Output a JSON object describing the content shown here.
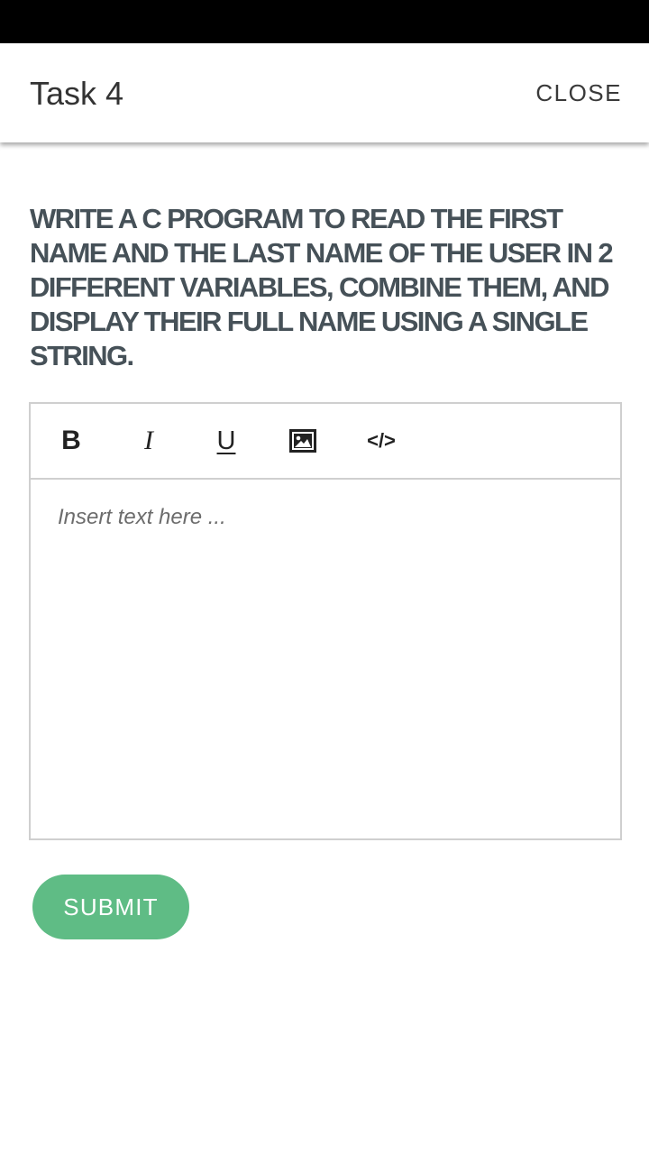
{
  "header": {
    "title": "Task 4",
    "close_label": "CLOSE"
  },
  "task": {
    "question": "WRITE A C PROGRAM TO READ THE FIRST NAME AND THE LAST NAME OF THE USER IN 2 DIFFERENT VARIABLES, COMBINE THEM, AND DISPLAY THEIR FULL NAME USING A SINGLE STRING."
  },
  "editor": {
    "toolbar": {
      "bold": "B",
      "italic": "I",
      "underline": "U",
      "image_icon": "image-icon",
      "code": "</>"
    },
    "placeholder": "Insert text here ...",
    "value": ""
  },
  "actions": {
    "submit_label": "SUBMIT"
  },
  "colors": {
    "status_bar": "#000000",
    "question_text": "#465158",
    "submit_bg": "#5fbc85",
    "border": "#cfcfcf"
  }
}
